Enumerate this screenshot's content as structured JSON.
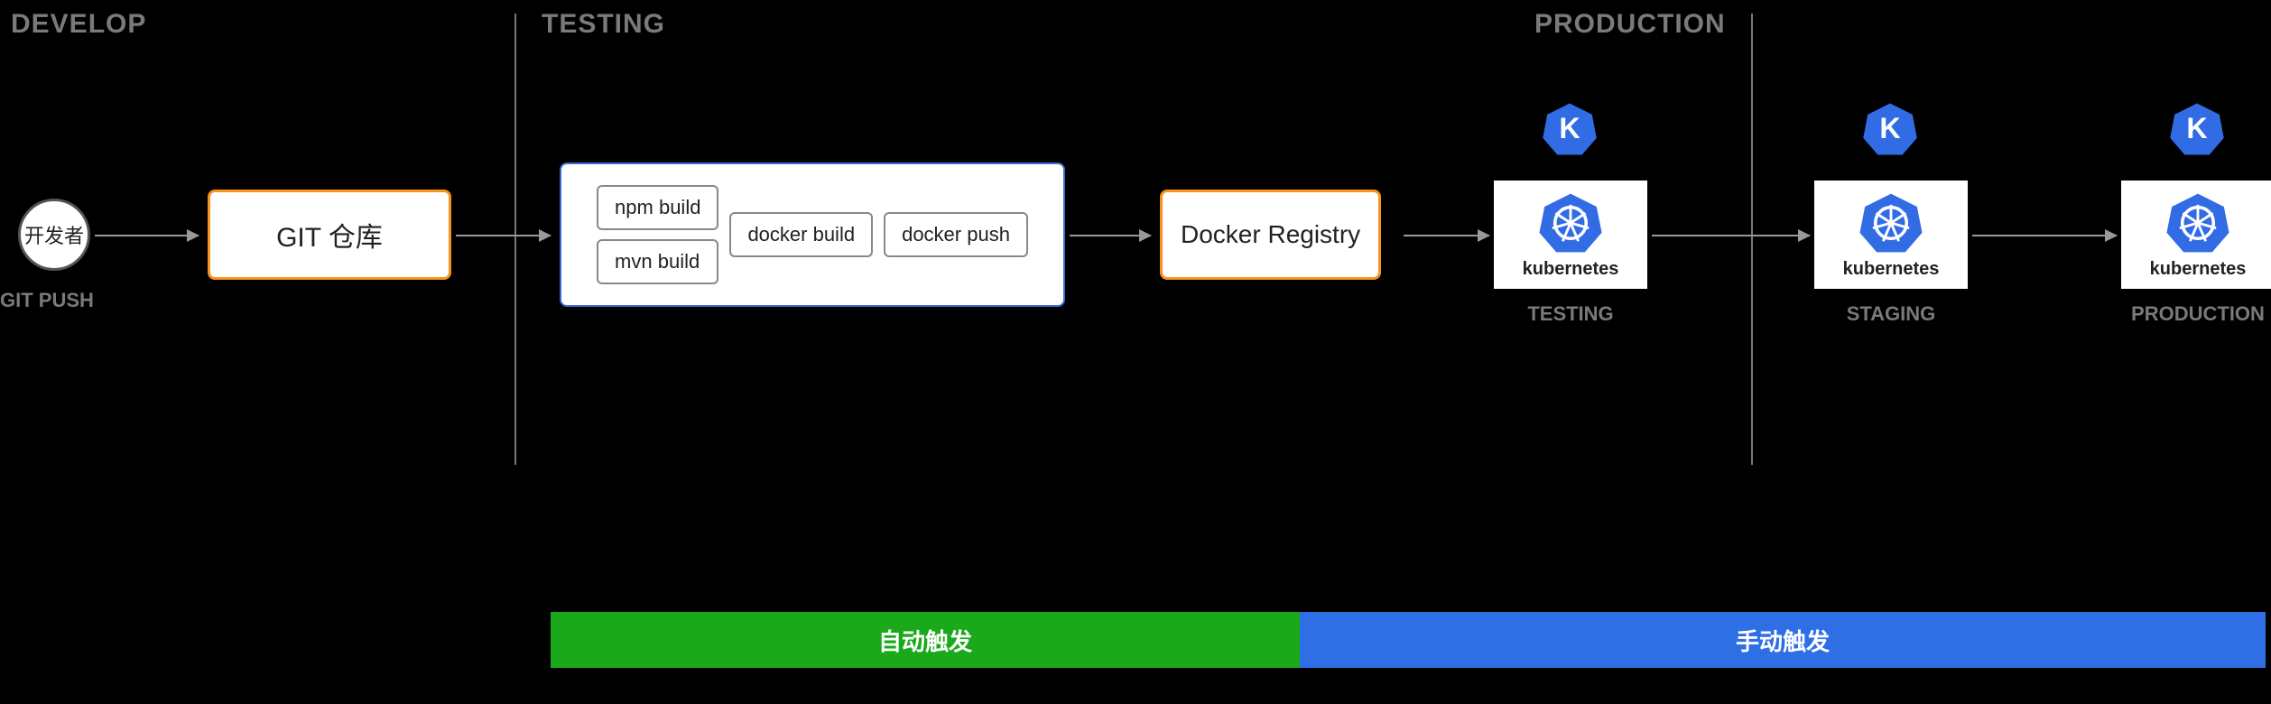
{
  "stages": {
    "develop": "DEVELOP",
    "testing": "TESTING",
    "production": "PRODUCTION"
  },
  "actor": {
    "label": "开发者",
    "caption": "GIT PUSH"
  },
  "git_repo": {
    "label": "GIT 仓库"
  },
  "build_steps": {
    "npm": "npm build",
    "mvn": "mvn build",
    "dbuild": "docker build",
    "dpush": "docker push"
  },
  "registry": {
    "label": "Docker Registry"
  },
  "k8s": {
    "brand": "kubernetes",
    "badge_letter": "K",
    "testing": {
      "caption": "TESTING"
    },
    "staging": {
      "caption": "STAGING"
    },
    "production": {
      "caption": "PRODUCTION"
    }
  },
  "footer": {
    "auto": "自动触发",
    "manual": "手动触发"
  },
  "colors": {
    "orange": "#f7941d",
    "blue_border": "#3b6bd6",
    "k8s_blue": "#326ce5",
    "green": "#1aa91a",
    "footer_blue": "#2f6fe6",
    "gray": "#7a7a7a"
  }
}
